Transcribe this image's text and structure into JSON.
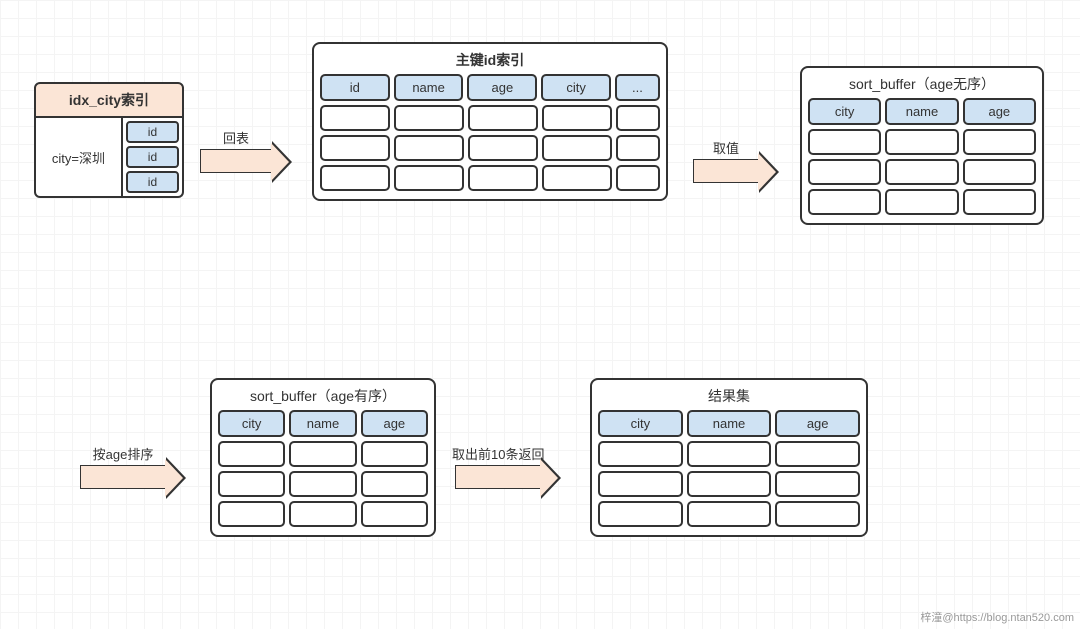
{
  "idx": {
    "title": "idx_city索引",
    "condition": "city=深圳",
    "ids": [
      "id",
      "id",
      "id"
    ]
  },
  "pk": {
    "title": "主键id索引",
    "headers": [
      "id",
      "name",
      "age",
      "city",
      "..."
    ]
  },
  "buf_unsorted": {
    "title": "sort_buffer（age无序）",
    "headers": [
      "city",
      "name",
      "age"
    ]
  },
  "buf_sorted": {
    "title": "sort_buffer（age有序）",
    "headers": [
      "city",
      "name",
      "age"
    ]
  },
  "result": {
    "title": "结果集",
    "headers": [
      "city",
      "name",
      "age"
    ]
  },
  "arrows": {
    "a1": "回表",
    "a2": "取值",
    "a3": "按age排序",
    "a4": "取出前10条返回"
  },
  "watermark": "梓潼@https://blog.ntan520.com"
}
